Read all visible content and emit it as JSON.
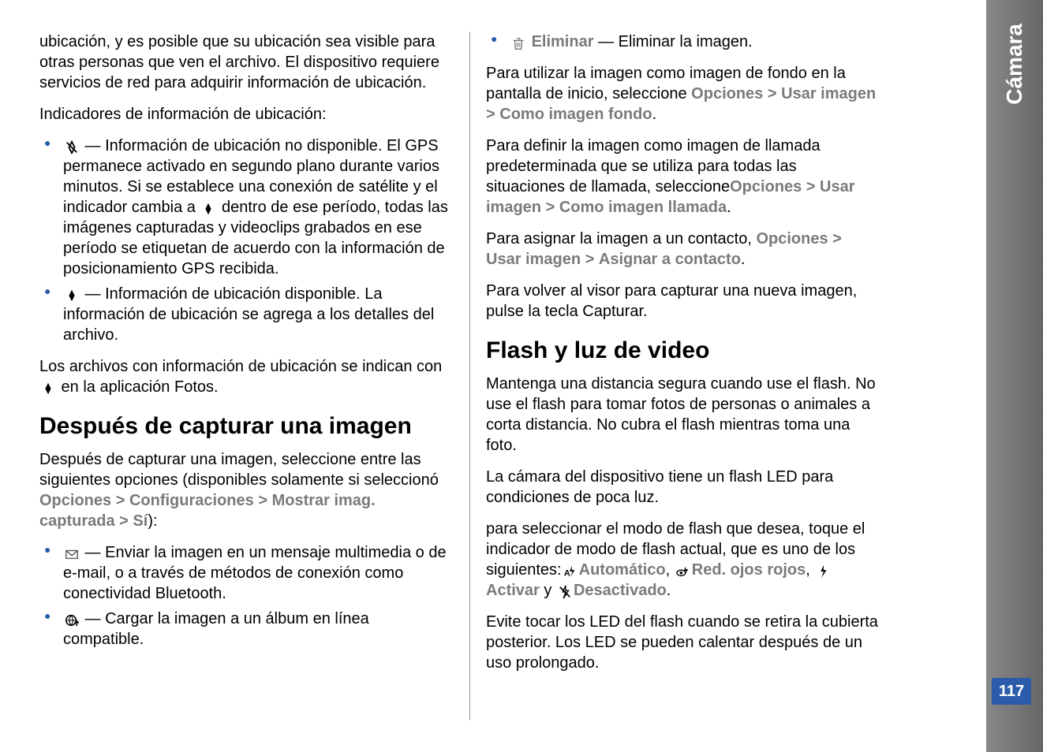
{
  "side": {
    "label": "Cámara",
    "page_number": "117"
  },
  "left": {
    "p1": "ubicación, y es posible que su ubicación sea visible para otras personas que ven el archivo. El dispositivo requiere servicios de red para adquirir información de ubicación.",
    "p2": "Indicadores de información de ubicación:",
    "li1a": " — Información de ubicación no disponible. El GPS permanece activado en segundo plano durante varios minutos. Si se establece una conexión de satélite y el indicador cambia a ",
    "li1b": " dentro de ese período, todas las imágenes capturadas y videoclips grabados en ese período se etiquetan de acuerdo con la información de posicionamiento GPS recibida.",
    "li2": " — Información de ubicación disponible. La información de ubicación se agrega a los detalles del archivo.",
    "p3a": "Los archivos con información de ubicación se indican con ",
    "p3b": " en la aplicación Fotos.",
    "h1": "Después de capturar una imagen",
    "p4a": "Después de capturar una imagen, seleccione entre las siguientes opciones (disponibles solamente si seleccionó ",
    "path1": "Opciones",
    "gt": ">",
    "path2": "Configuraciones",
    "path3": "Mostrar imag. capturada",
    "path4": "Sí",
    "p4b": "):",
    "li3": " — Enviar la imagen en un mensaje multimedia o de e-mail, o a través de métodos de conexión como conectividad Bluetooth.",
    "li4": " — Cargar la imagen a un álbum en línea compatible."
  },
  "right": {
    "li1_label": "Eliminar",
    "li1": " — Eliminar la imagen.",
    "p1a": "Para utilizar la imagen como imagen de fondo en la pantalla de inicio, seleccione ",
    "opt": "Opciones",
    "gt": ">",
    "usar": "Usar imagen",
    "fondo": "Como imagen fondo",
    "p2a": "Para definir la imagen como imagen de llamada predeterminada que se utiliza para todas las situaciones de llamada, seleccione",
    "llamada": "Como imagen llamada",
    "p3a": "Para asignar la imagen a un contacto, ",
    "asignar": "Asignar a contacto",
    "p4": "Para volver al visor para capturar una nueva imagen, pulse la tecla Capturar.",
    "h1": "Flash y luz de video",
    "p5": "Mantenga una distancia segura cuando use el flash. No use el flash para tomar fotos de personas o animales a corta distancia. No cubra el flash mientras toma una foto.",
    "p6": "La cámara del dispositivo tiene un flash LED para condiciones de poca luz.",
    "p7a": "para seleccionar el modo de flash que desea, toque el indicador de modo de flash actual, que es uno de los siguientes:",
    "auto": "Automático",
    "red": "Red. ojos rojos",
    "activar": "Activar",
    "y": " y ",
    "desact": "Desactivado",
    "p8": "Evite tocar los LED del flash cuando se retira la cubierta posterior. Los LED se pueden calentar después de un uso prolongado."
  }
}
